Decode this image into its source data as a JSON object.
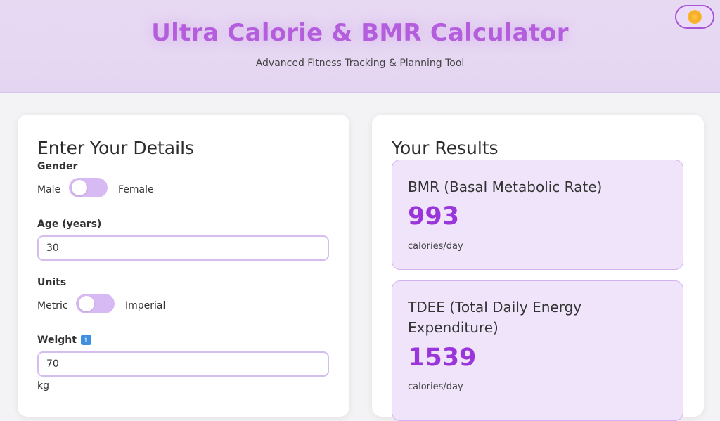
{
  "header": {
    "title": "Ultra Calorie & BMR Calculator",
    "subtitle": "Advanced Fitness Tracking & Planning Tool",
    "theme_toggle_icon": "sun-icon"
  },
  "details": {
    "heading": "Enter Your Details",
    "gender": {
      "label": "Gender",
      "left_option": "Male",
      "right_option": "Female"
    },
    "age": {
      "label": "Age (years)",
      "value": "30"
    },
    "units": {
      "label": "Units",
      "left_option": "Metric",
      "right_option": "Imperial"
    },
    "weight": {
      "label": "Weight",
      "info_icon": "info-icon",
      "value": "70",
      "unit": "kg"
    }
  },
  "results": {
    "heading": "Your Results",
    "bmr": {
      "title": "BMR (Basal Metabolic Rate)",
      "value": "993",
      "unit": "calories/day"
    },
    "tdee": {
      "title": "TDEE (Total Daily Energy Expenditure)",
      "value": "1539",
      "unit": "calories/day"
    }
  },
  "colors": {
    "accent": "#9a35d9",
    "title": "#b45ede",
    "header_bg": "#e8d9f3",
    "result_bg": "#f0e4fb"
  }
}
